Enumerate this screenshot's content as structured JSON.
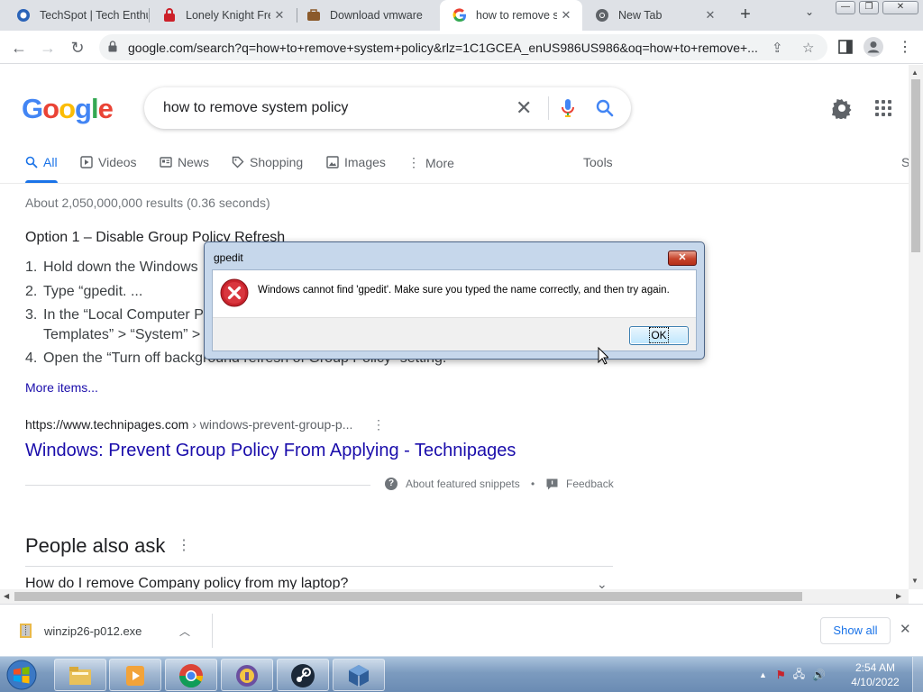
{
  "tabs": [
    {
      "title": "TechSpot | Tech Enthusiasts",
      "icon": "techspot-icon"
    },
    {
      "title": "Lonely Knight Free",
      "icon": "lastpass-icon"
    },
    {
      "title": "Download vmware",
      "icon": "briefcase-icon"
    },
    {
      "title": "how to remove system policy",
      "icon": "google-icon"
    },
    {
      "title": "New Tab",
      "icon": "chrome-icon"
    }
  ],
  "window_controls": {
    "minimize": "—",
    "restore": "❐",
    "close": "✕"
  },
  "toolbar": {
    "url": "google.com/search?q=how+to+remove+system+policy&rlz=1C1GCEA_enUS986US986&oq=how+to+remove+..."
  },
  "google": {
    "logo": [
      "G",
      "o",
      "o",
      "g",
      "l",
      "e"
    ],
    "logo_colors": [
      "#4285f4",
      "#ea4335",
      "#fbbc05",
      "#4285f4",
      "#34a853",
      "#ea4335"
    ],
    "query": "how to remove system policy"
  },
  "search_tabs": [
    {
      "label": "All",
      "icon": "search-icon"
    },
    {
      "label": "Videos",
      "icon": "video-icon"
    },
    {
      "label": "News",
      "icon": "news-icon"
    },
    {
      "label": "Shopping",
      "icon": "tag-icon"
    },
    {
      "label": "Images",
      "icon": "image-icon"
    },
    {
      "label": "More",
      "icon": "more-dots-icon"
    }
  ],
  "tools_label": "Tools",
  "cut_label": "S",
  "results": {
    "stats": "About 2,050,000,000 results (0.36 seconds)",
    "snippet_title": "Option 1 – Disable Group Policy Refresh",
    "list": [
      {
        "num": "1.",
        "text": "Hold down the Windows"
      },
      {
        "num": "2.",
        "text": "Type “gpedit. ..."
      },
      {
        "num": "3.",
        "text": "In the “Local Computer P"
      },
      {
        "num": "",
        "text": "Templates” > “System” >"
      },
      {
        "num": "4.",
        "text": "Open the “Turn off background refresh of Group Policy” setting."
      }
    ],
    "more_items": "More items...",
    "source_domain": "https://www.technipages.com",
    "source_crumb": " › windows-prevent-group-p...",
    "link_title": "Windows: Prevent Group Policy From Applying - Technipages",
    "about_snippets": "About featured snippets",
    "bullet": "•",
    "feedback": "Feedback",
    "people_also_ask": "People also ask",
    "paa_question": "How do I remove Company policy from my laptop?"
  },
  "download": {
    "filename": "winzip26-p012.exe",
    "show_all": "Show all"
  },
  "dialog": {
    "title": "gpedit",
    "message": "Windows cannot find 'gpedit'. Make sure you typed the name correctly, and then try again.",
    "ok": "OK"
  },
  "clock": {
    "time": "2:54 AM",
    "date": "4/10/2022"
  },
  "colors": {
    "accent": "#1a73e8",
    "link": "#1a0dab",
    "error": "#c8232c"
  }
}
